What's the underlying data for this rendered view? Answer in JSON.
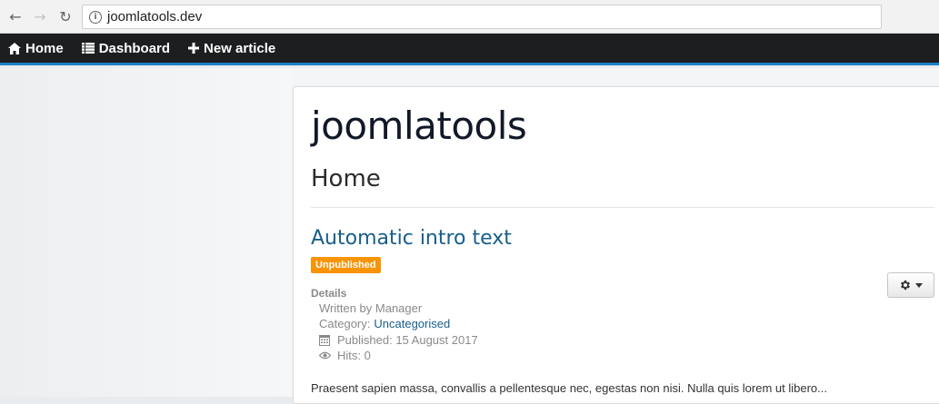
{
  "browser": {
    "url": "joomlatools.dev"
  },
  "topnav": {
    "items": [
      {
        "label": "Home",
        "icon": "home-icon"
      },
      {
        "label": "Dashboard",
        "icon": "list-icon"
      },
      {
        "label": "New article",
        "icon": "plus-icon"
      }
    ]
  },
  "site": {
    "title": "joomlatools",
    "page_heading": "Home"
  },
  "article": {
    "title": "Automatic intro text",
    "status_badge": "Unpublished",
    "details_label": "Details",
    "written_by": "Written by Manager",
    "category_label": "Category:",
    "category_value": "Uncategorised",
    "published": "Published: 15 August 2017",
    "hits": "Hits: 0",
    "intro": "Praesent sapien massa, convallis a pellentesque nec, egestas non nisi. Nulla quis lorem ut libero..."
  },
  "colors": {
    "nav_bg": "#1d1e20",
    "nav_accent": "#1e7ec8",
    "link": "#175e8c",
    "badge": "#f89406"
  }
}
